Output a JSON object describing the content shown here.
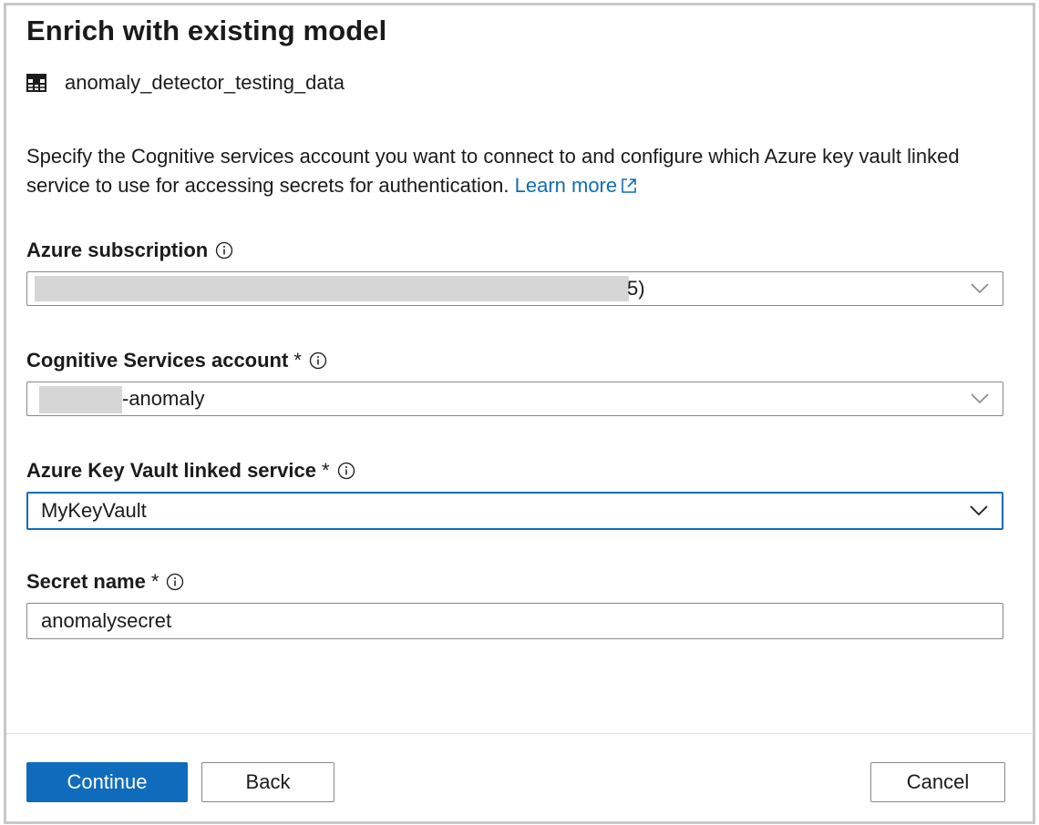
{
  "dialog": {
    "title": "Enrich with existing model",
    "dataset_name": "anomaly_detector_testing_data",
    "description": "Specify the Cognitive services account you want to connect to and configure which Azure key vault linked service to use for accessing secrets for authentication.",
    "learn_more": "Learn more"
  },
  "fields": {
    "subscription": {
      "label": "Azure subscription",
      "value_suffix": "5)"
    },
    "cognitive_account": {
      "label": "Cognitive Services account",
      "required": "*",
      "value_suffix": "-anomaly"
    },
    "key_vault": {
      "label": "Azure Key Vault linked service",
      "required": "*",
      "value": "MyKeyVault"
    },
    "secret": {
      "label": "Secret name",
      "required": "*",
      "value": "anomalysecret"
    }
  },
  "buttons": {
    "continue": "Continue",
    "back": "Back",
    "cancel": "Cancel"
  },
  "colors": {
    "accent": "#0f6cbd",
    "border": "#8a8886",
    "text": "#1b1b1b"
  },
  "icons": {
    "dataset": "table-icon",
    "info": "info-icon",
    "external": "external-link-icon",
    "dropdown": "chevron-down-icon"
  }
}
